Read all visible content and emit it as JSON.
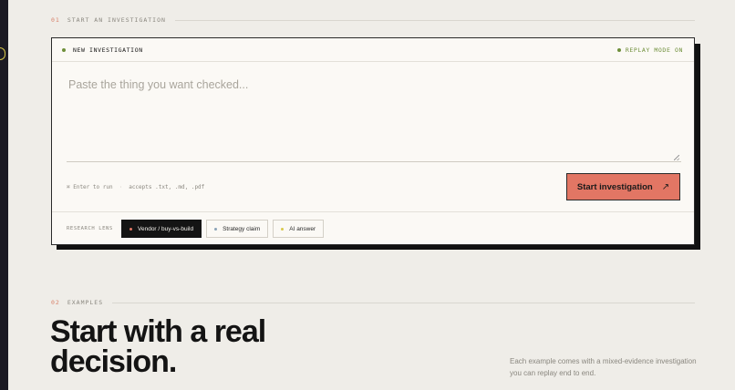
{
  "section1": {
    "num": "01",
    "label": "START AN INVESTIGATION"
  },
  "card": {
    "title": "NEW INVESTIGATION",
    "mode": "REPLAY MODE ON",
    "placeholder": "Paste the thing you want checked...",
    "hint_run": "⌘ Enter to run",
    "hint_sep": "·",
    "hint_accepts": "accepts .txt, .md, .pdf",
    "start_label": "Start investigation",
    "start_arrow": "↗"
  },
  "lens": {
    "label": "RESEARCH LENS",
    "options": [
      {
        "label": "Vendor / buy-vs-build",
        "selected": true,
        "dot_color": "#e27664"
      },
      {
        "label": "Strategy claim",
        "selected": false,
        "dot_color": "#8aa3b8"
      },
      {
        "label": "AI answer",
        "selected": false,
        "dot_color": "#d8c84a"
      }
    ]
  },
  "section2": {
    "num": "02",
    "label": "EXAMPLES"
  },
  "examples": {
    "headline": "Start with a real decision.",
    "subcopy": "Each example comes with a mixed-evidence investigation you can replay end to end."
  },
  "colors": {
    "accent": "#e27664",
    "live": "#6f8f3a",
    "background": "#efede8"
  }
}
